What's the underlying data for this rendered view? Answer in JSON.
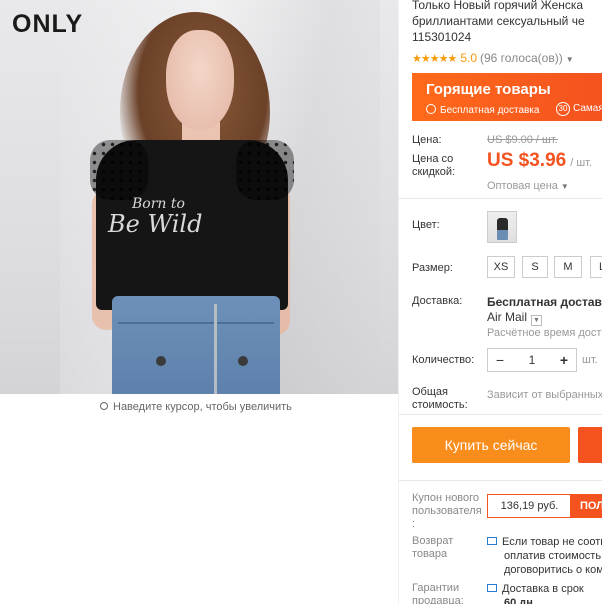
{
  "image": {
    "brand": "ONLY",
    "print_line1": "Born to",
    "print_line2": "Be Wild",
    "zoom_hint": "Наведите курсор, чтобы увеличить"
  },
  "product": {
    "title_line1": "Только Новый горячий Женска",
    "title_line2": "бриллиантами сексуальный че",
    "title_line3": "115301024",
    "rating_score": "5.0",
    "rating_votes": "(96 голоса(ов))",
    "stars": "★★★★★"
  },
  "banner": {
    "title": "Горящие товары",
    "free_shipping": "Бесплатная доставка",
    "badge": "30",
    "badge_text": "Самая"
  },
  "price": {
    "price_label": "Цена:",
    "old_price": "US $9.00 / шт.",
    "discount_label_line1": "Цена со",
    "discount_label_line2": "скидкой:",
    "new_price": "US $3.96",
    "unit": "/ шт.",
    "wholesale": "Оптовая цена"
  },
  "color": {
    "label": "Цвет:",
    "selected": "black"
  },
  "size": {
    "label": "Размер:",
    "options": [
      "XS",
      "S",
      "M",
      "L"
    ]
  },
  "shipping": {
    "label": "Доставка:",
    "method": "Бесплатная доставка",
    "carrier": "Air Mail",
    "estimate": "Расчётное время доста"
  },
  "quantity": {
    "label": "Количество:",
    "value": "1",
    "minus": "−",
    "plus": "+",
    "unit": "шт."
  },
  "total": {
    "label_line1": "Общая",
    "label_line2": "стоимость:",
    "value": "Зависит от выбранных"
  },
  "actions": {
    "buy_now": "Купить сейчас"
  },
  "coupon": {
    "label_line1": "Купон нового",
    "label_line2": "пользователя",
    "label_line3": ":",
    "amount": "136,19 руб.",
    "button": "ПОЛ"
  },
  "returns": {
    "label_line1": "Возврат",
    "label_line2": "товара",
    "text_line1": "Если товар не соотв",
    "text_line2": "оплатив стоимость",
    "text_line3": "договоритись о ком"
  },
  "guarantee": {
    "label_line1": "Гарантии",
    "label_line2": "продавца:",
    "text_line1": "Доставка в срок",
    "text_line2": "60 дн"
  },
  "colors": {
    "accent": "#f4521f",
    "buy_button": "#f98d1b",
    "star": "#f79a0b",
    "banner": "#ff6a1a"
  }
}
